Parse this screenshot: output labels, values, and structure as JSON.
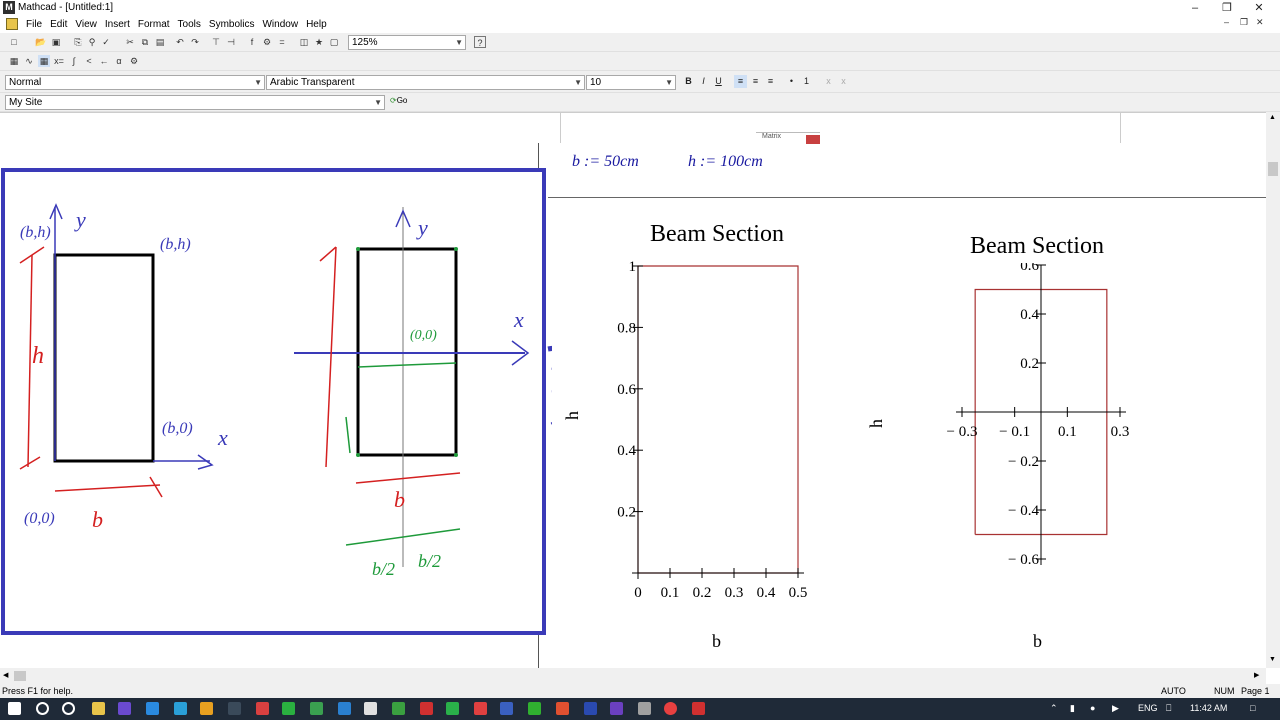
{
  "window": {
    "title": "Mathcad - [Untitled:1]"
  },
  "menu": [
    "File",
    "Edit",
    "View",
    "Insert",
    "Format",
    "Tools",
    "Symbolics",
    "Window",
    "Help"
  ],
  "toolbar": {
    "zoom": "125%"
  },
  "format_bar": {
    "style": "Normal",
    "font": "Arabic Transparent",
    "size": "10",
    "bold": "B",
    "italic": "I",
    "underline": "U"
  },
  "resource_bar": {
    "site": "My Site",
    "go": "Go"
  },
  "worksheet": {
    "popup_label": "Matrix",
    "definitions": [
      "b := 50cm",
      "h := 100cm"
    ]
  },
  "sketch_labels": {
    "left": {
      "y": "y",
      "top_left": "(b,h)",
      "top_right": "(b,h)",
      "bottom_right": "(b,0)",
      "x": "x",
      "origin": "(0,0)",
      "h": "h",
      "b": "b"
    },
    "right": {
      "y": "y",
      "x": "x",
      "center": "(0,0)",
      "b": "b",
      "half_b1": "b/2",
      "half_b2": "b/2"
    }
  },
  "plot1": {
    "title": "Beam Section",
    "xlabel": "b",
    "ylabel": "h",
    "xticks": [
      "0",
      "0.1",
      "0.2",
      "0.3",
      "0.4",
      "0.5"
    ],
    "yticks": [
      "1",
      "0.8",
      "0.6",
      "0.4",
      "0.2"
    ]
  },
  "plot2": {
    "title": "Beam Section",
    "xlabel": "b",
    "ylabel": "h",
    "xticks": [
      "− 0.3",
      "− 0.1",
      "0.1",
      "0.3"
    ],
    "yticks": [
      "0.6",
      "0.4",
      "0.2",
      "− 0.2",
      "− 0.4",
      "− 0.6"
    ]
  },
  "chart_data": [
    {
      "type": "line",
      "title": "Beam Section",
      "xlabel": "b",
      "ylabel": "h",
      "xlim": [
        0,
        0.5
      ],
      "ylim": [
        0,
        1
      ],
      "series": [
        {
          "x": [
            0,
            0.5,
            0.5,
            0,
            0
          ],
          "y": [
            0,
            0,
            1,
            1,
            0
          ]
        }
      ]
    },
    {
      "type": "line",
      "title": "Beam Section",
      "xlabel": "b",
      "ylabel": "h",
      "xlim": [
        -0.3,
        0.3
      ],
      "ylim": [
        -0.6,
        0.6
      ],
      "series": [
        {
          "x": [
            -0.25,
            0.25,
            0.25,
            -0.25,
            -0.25
          ],
          "y": [
            -0.5,
            -0.5,
            0.5,
            0.5,
            -0.5
          ]
        }
      ]
    }
  ],
  "status": {
    "help": "Press F1 for help.",
    "auto": "AUTO",
    "num": "NUM",
    "page": "Page 1"
  },
  "taskbar": {
    "lang": "ENG",
    "time": "11:42 AM"
  },
  "colors": {
    "sketch_blue": "#3a3ab8",
    "sketch_red": "#d42020",
    "sketch_green": "#1e9a3a",
    "plot_line": "#a83232"
  }
}
